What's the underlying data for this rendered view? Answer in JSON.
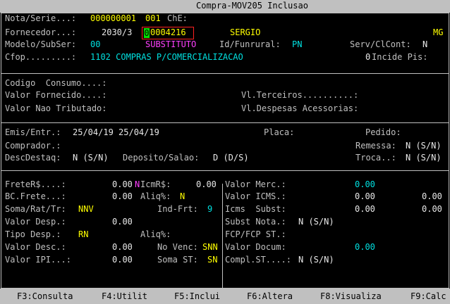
{
  "window": {
    "title": "Compra-MOV205  Inclusao"
  },
  "header": {
    "nota_label": "Nota/Serie...:",
    "nota_value": "000000001",
    "serie_value": "001",
    "chave_label": "ChE:",
    "fornecedor_label": "Fornecedor...:",
    "fornecedor_code": "2030/3",
    "fornecedor_cursor": "0",
    "fornecedor_rest": "0004216",
    "fornecedor_name": "SERGIO",
    "fornecedor_uf": "MG",
    "modelo_label": "Modelo/SubSer:",
    "modelo_value": "00",
    "modelo_desc": "SUBSTITUTO",
    "funrural_label": "Id/Funrural:",
    "funrural_value": "PN",
    "serv_label": "Serv/ClCont:",
    "serv_value": "N",
    "cfop_label": "Cfop.........:",
    "cfop_value": "1102 COMPRAS P/COMERCIALIZACAO",
    "incide_prefix": "0",
    "incide_label": "Incide Pis:"
  },
  "consumo": {
    "codigo_label": "Codigo  Consumo....:",
    "fornecido_label": "Valor Fornecido....:",
    "nao_tributado_label": "Valor Nao Tributado:",
    "terceiros_label": "Vl.Terceiros..........:",
    "despesas_label": "Vl.Despesas Acessorias:"
  },
  "emissao": {
    "emis_label": "Emis/Entr.:",
    "emis_value": "25/04/19 25/04/19",
    "placa_label": "Placa:",
    "pedido_label": "Pedido:",
    "comprador_label": "Comprador.:",
    "remessa_label": "Remessa:",
    "remessa_value": "N (S/N)",
    "descdestaq_label": "DescDestaq:",
    "descdestaq_value": "N (S/N)",
    "deposito_label": "Deposito/Salao:",
    "deposito_value": "D (D/S)",
    "troca_label": "Troca..:",
    "troca_value": "N (S/N)"
  },
  "left_totals": {
    "frete_label": "FreteR$....:",
    "frete_value": "0.00",
    "frete_flag": "N",
    "icmsr_label": "IcmR$:",
    "icmsr_value": "0.00",
    "bcfrete_label": "BC.Frete...:",
    "bcfrete_value": "0.00",
    "aliq_label": "Aliq%:",
    "aliq_value": "N",
    "soma_label": "Soma/Rat/Tr:",
    "soma_value": "NNV",
    "indfrt_label": "Ind-Frt:",
    "indfrt_value": "9",
    "despesa_label": "Valor Desp.:",
    "despesa_value": "0.00",
    "tipodesp_label": "Tipo Desp.:",
    "tipodesp_value": "RN",
    "aliq2_label": "Aliq%:",
    "desconto_label": "Valor Desc.:",
    "desconto_value": "0.00",
    "novenc_label": "No Venc:",
    "novenc_value": "SNN",
    "ipi_label": "Valor IPI...:",
    "ipi_value": "0.00",
    "somast_label": "Soma ST:",
    "somast_value": "SN"
  },
  "right_totals": {
    "merc_label": "Valor Merc.:",
    "merc_value": "0.00",
    "icms_label": "Valor ICMS.:",
    "icms_value1": "0.00",
    "icms_value2": "0.00",
    "icmssubst_label": "Icms  Subst:",
    "icmssubst_value1": "0.00",
    "icmssubst_value2": "0.00",
    "substnota_label": "Subst Nota.:",
    "substnota_value": "N (S/N)",
    "fcp_label": "FCP/FCP ST.:",
    "docum_label": "Valor Docum:",
    "docum_value": "0.00",
    "complst_label": "Compl.ST....:",
    "complst_value": "N (S/N)"
  },
  "fkeys": [
    "F3:Consulta",
    "F4:Utilit",
    "F5:Inclui",
    "F6:Altera",
    "F8:Visualiza",
    "F9:Calc"
  ]
}
